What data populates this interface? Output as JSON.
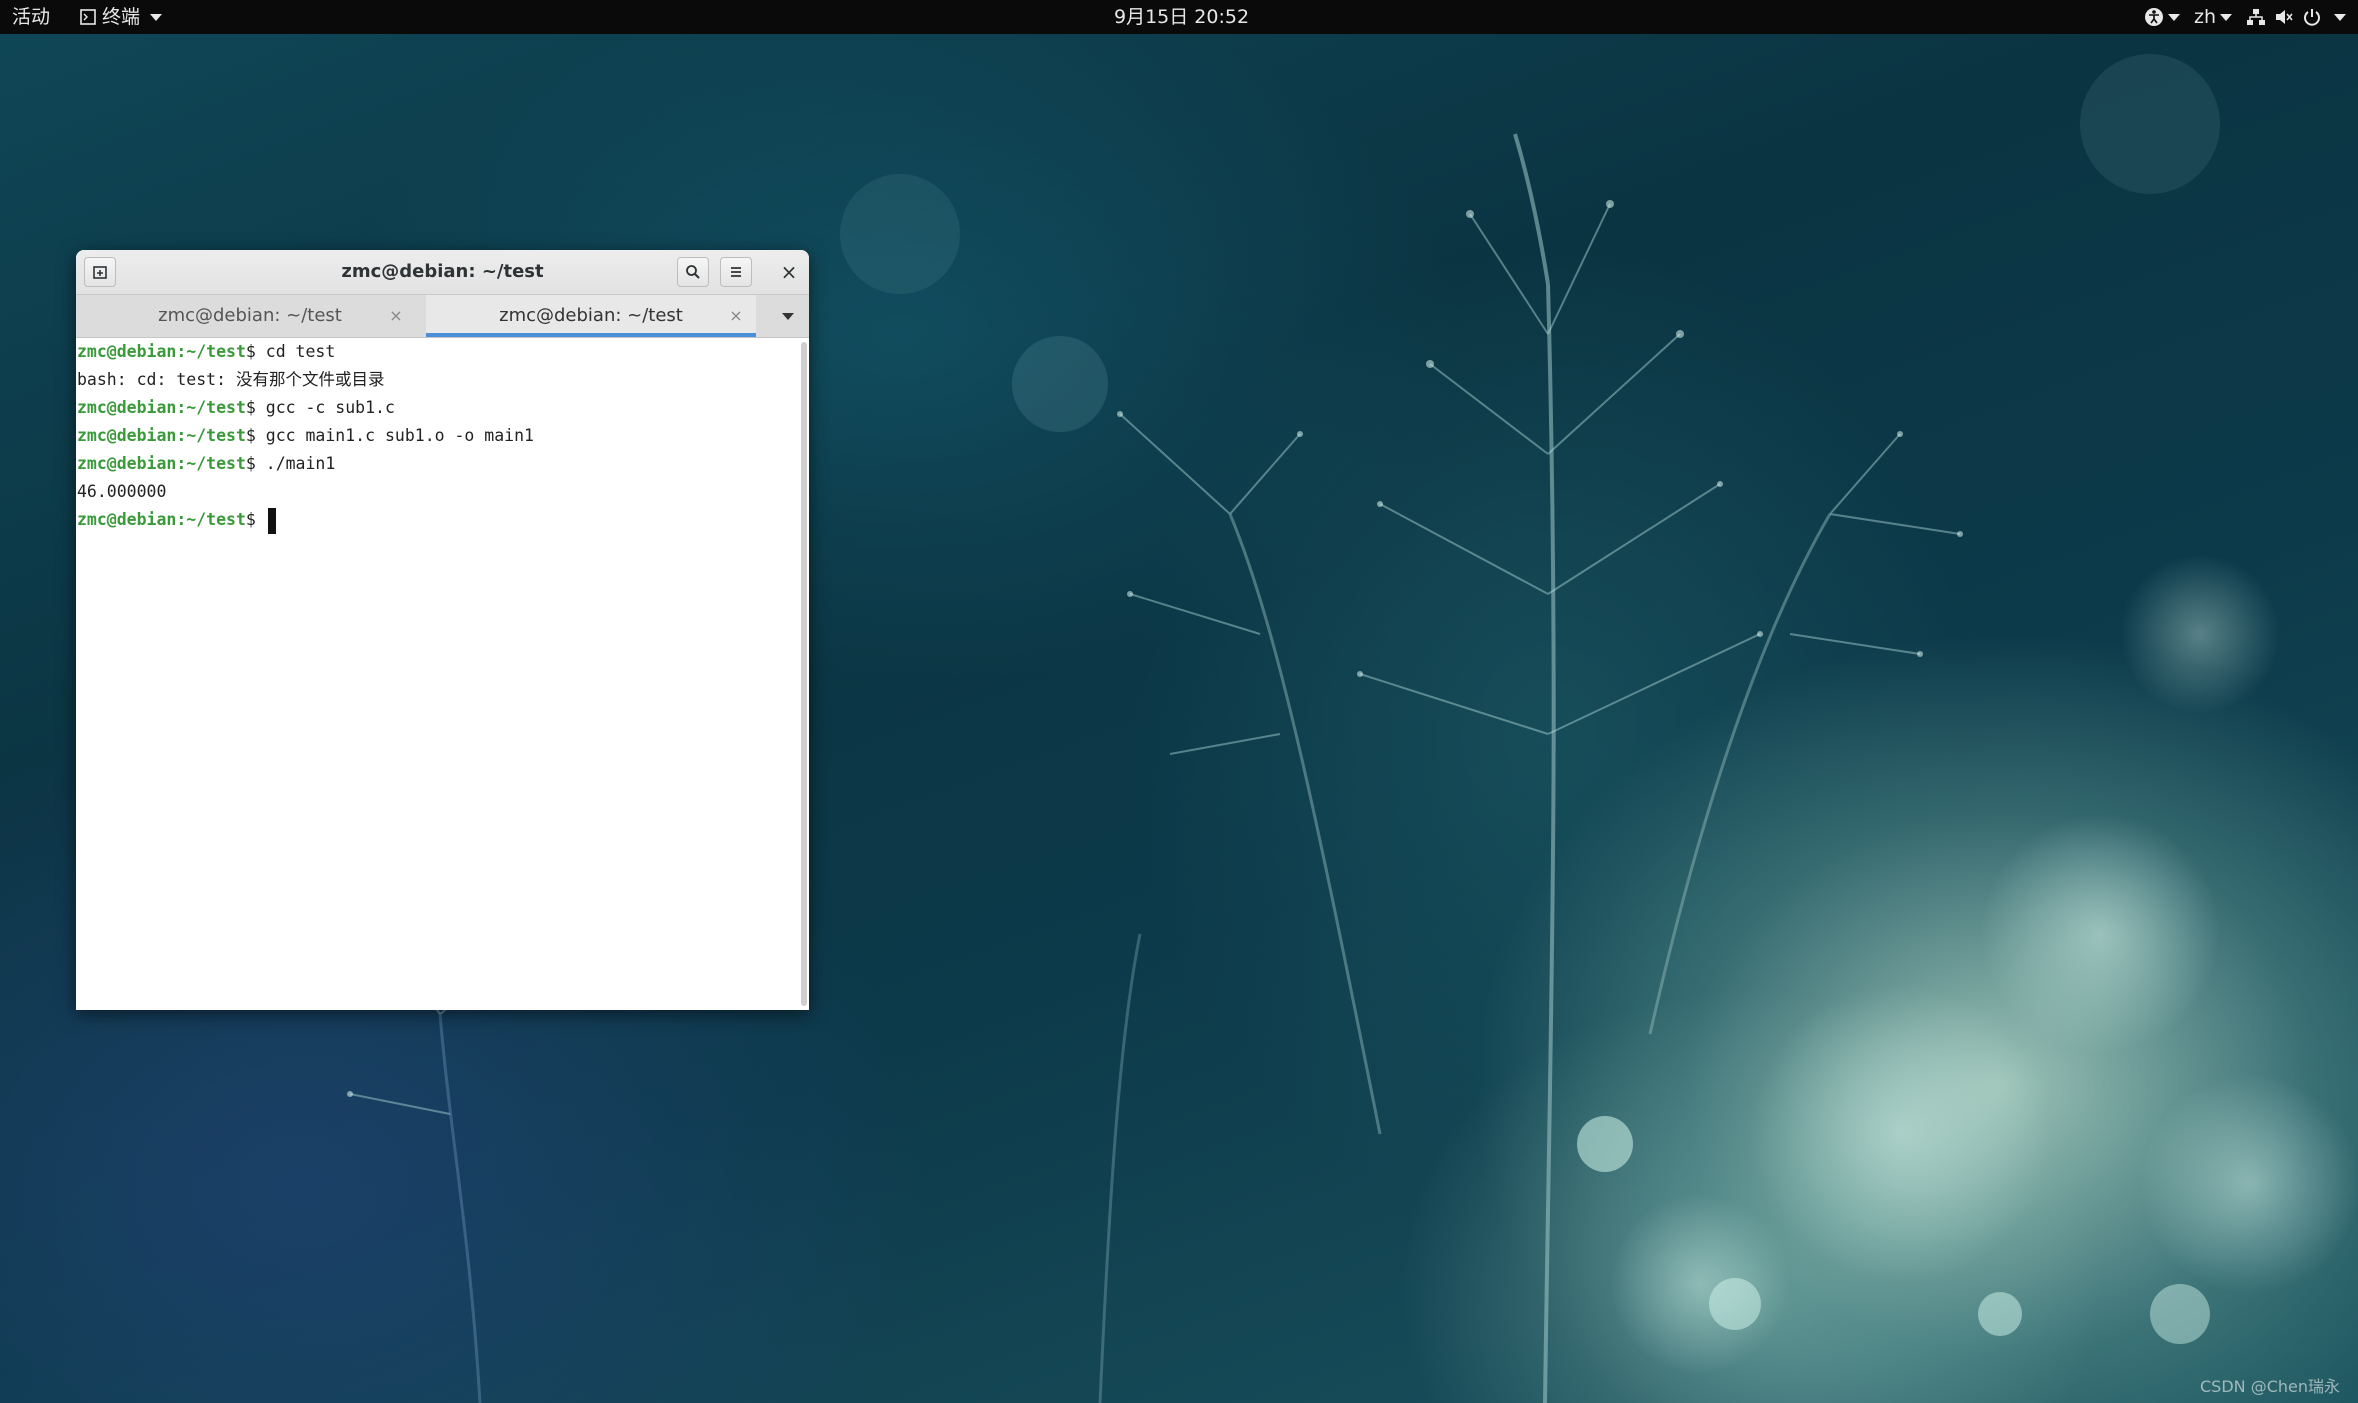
{
  "topbar": {
    "activities": "活动",
    "app_menu": "终端",
    "clock": "9月15日  20:52",
    "language": "zh"
  },
  "window": {
    "title": "zmc@debian: ~/test",
    "tabs": [
      {
        "label": "zmc@debian: ~/test",
        "active": false
      },
      {
        "label": "zmc@debian: ~/test",
        "active": true
      }
    ]
  },
  "terminal": {
    "lines": [
      {
        "prompt": "zmc@debian:~/test",
        "text": "$ cd test"
      },
      {
        "prompt": "",
        "text": "bash: cd: test: 没有那个文件或目录"
      },
      {
        "prompt": "zmc@debian:~/test",
        "text": "$ gcc -c sub1.c"
      },
      {
        "prompt": "zmc@debian:~/test",
        "text": "$ gcc main1.c sub1.o -o main1"
      },
      {
        "prompt": "zmc@debian:~/test",
        "text": "$ ./main1"
      },
      {
        "prompt": "",
        "text": "46.000000"
      },
      {
        "prompt": "zmc@debian:~/test",
        "text": "$ "
      }
    ]
  },
  "watermark": "CSDN @Chen瑞永",
  "colors": {
    "prompt": "#3a9a3a",
    "tab_accent": "#4a90d9",
    "topbar": "#0a0a0a"
  },
  "icons": [
    "terminal-icon",
    "accessibility-icon",
    "network-icon",
    "volume-muted-icon",
    "power-icon",
    "new-tab-icon",
    "search-icon",
    "hamburger-menu-icon",
    "close-icon",
    "tab-close-icon",
    "tabs-dropdown-icon"
  ]
}
